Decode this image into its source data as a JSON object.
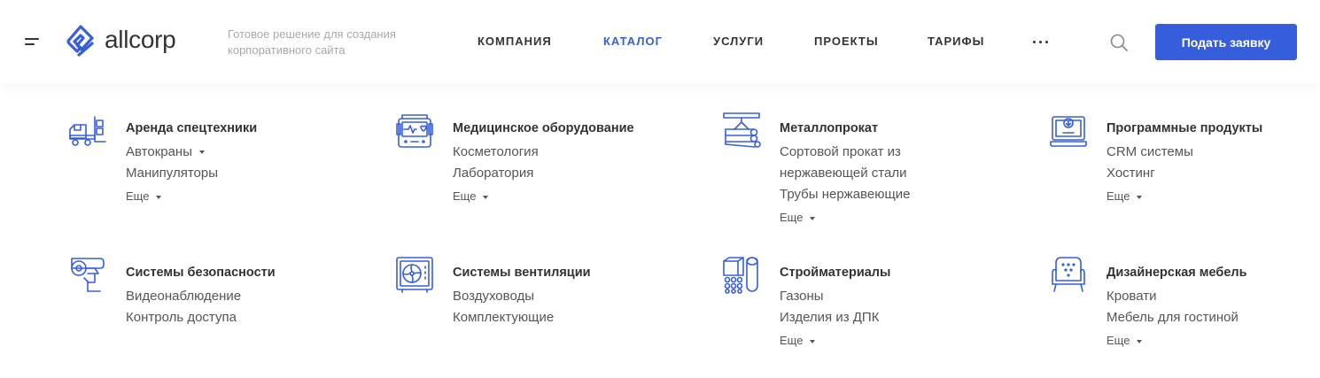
{
  "header": {
    "logo_text": "allcorp",
    "slogan": "Готовое решение для создания корпоративного сайта",
    "nav": [
      {
        "label": "КОМПАНИЯ",
        "active": false
      },
      {
        "label": "КАТАЛОГ",
        "active": true
      },
      {
        "label": "УСЛУГИ",
        "active": false
      },
      {
        "label": "ПРОЕКТЫ",
        "active": false
      },
      {
        "label": "ТАРИФЫ",
        "active": false
      }
    ],
    "cta_label": "Подать заявку"
  },
  "colors": {
    "accent": "#365edc",
    "text": "#333333",
    "muted": "#a9a9a9"
  },
  "catalog": [
    {
      "title": "Аренда спецтехники",
      "icon": "forklift-truck-icon",
      "links": [
        "Автокраны",
        "Манипуляторы"
      ],
      "link_dropdown": [
        true,
        false
      ],
      "more": "Еще"
    },
    {
      "title": "Медицинское оборудование",
      "icon": "medical-monitor-icon",
      "links": [
        "Косметология",
        "Лаборатория"
      ],
      "more": "Еще"
    },
    {
      "title": "Металлопрокат",
      "icon": "metal-pipes-icon",
      "links": [
        "Сортовой прокат из",
        "нержавеющей стали",
        "Трубы нержавеющие"
      ],
      "more": "Еще"
    },
    {
      "title": "Программные продукты",
      "icon": "laptop-download-icon",
      "links": [
        "CRM системы",
        "Хостинг"
      ],
      "more": "Еще"
    },
    {
      "title": "Системы безопасности",
      "icon": "security-camera-icon",
      "links": [
        "Видеонаблюдение",
        "Контроль доступа"
      ]
    },
    {
      "title": "Системы вентиляции",
      "icon": "ventilation-fan-icon",
      "links": [
        "Воздуховоды",
        "Комплектующие"
      ]
    },
    {
      "title": "Стройматериалы",
      "icon": "building-materials-icon",
      "links": [
        "Газоны",
        "Изделия из ДПК"
      ],
      "more": "Еще"
    },
    {
      "title": "Дизайнерская мебель",
      "icon": "armchair-icon",
      "links": [
        "Кровати",
        "Мебель для гостиной"
      ],
      "more": "Еще"
    }
  ]
}
